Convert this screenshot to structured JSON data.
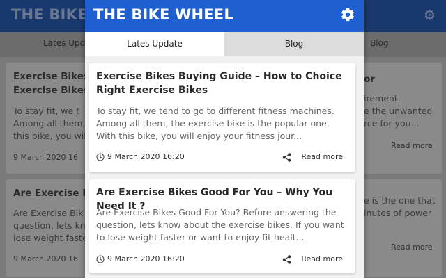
{
  "app": {
    "title": "THE BIKE WHEEL",
    "colors": {
      "header": "#1f5fcf",
      "background": "#f1f1f1",
      "card": "#ffffff"
    }
  },
  "tabs": [
    {
      "label": "Lates Update",
      "active": true
    },
    {
      "label": "Blog",
      "active": false
    }
  ],
  "posts": [
    {
      "title": "Exercise Bikes Buying Guide – How to Choice Right Exercise Bikes",
      "excerpt": "To stay fit, we tend to go to different fitness machines. Among all them, the exercise bike is the popular one. With this bike, you will enjoy your fitness jour...",
      "date": "9 March 2020 16:20",
      "read_more": "Read more"
    },
    {
      "title": "Are Exercise Bikes Good For You – Why You Need It ?",
      "excerpt": "Are Exercise Bikes Good For You? Before answering the question, lets know about the exercise bikes. If you want to lose weight faster or want to enjoy fit healt...",
      "date": "9 March 2020 16:20",
      "read_more": "Read more"
    }
  ],
  "background": {
    "title": "THE BIKE WH",
    "tab_left": "Lates Upda",
    "tab_right": "Blog",
    "card1_title_l1": "Exercise Bikes",
    "card1_title_l2": "Exercise Bikes",
    "card1_text_l1": "To stay fit, we t",
    "card1_text_l2": "Among all them,",
    "card1_text_l3": "this bike, you wil",
    "card1_date": "9 March 2020 16",
    "card2_title": "Are Exercise Bi",
    "card2_text_l1": "Are Exercise Bik",
    "card2_text_l2": "question, lets kn",
    "card2_text_l3": "lose weight faste",
    "card2_date": "9 March 2020 16",
    "right1_title": "or",
    "right1_text_l1": "irement.",
    "right1_text_l2": "e the unwanted",
    "right1_text_l3": "rce for you...",
    "right1_read": "Read more",
    "right2_text_l1": "e is the one that",
    "right2_text_l2": "inutes of power",
    "right2_read": "Read more"
  },
  "icons": {
    "settings": "gear-icon",
    "clock": "clock-icon",
    "share": "share-icon"
  }
}
